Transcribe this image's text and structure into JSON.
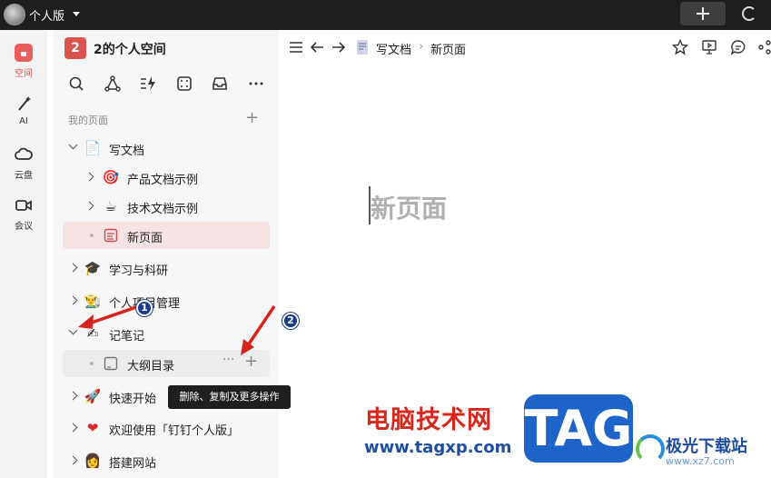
{
  "topbar": {
    "workspace_label": "个人版"
  },
  "rail": {
    "items": [
      {
        "label": "空间",
        "icon": "space-icon"
      },
      {
        "label": "AI",
        "icon": "ai-wand-icon"
      },
      {
        "label": "云盘",
        "icon": "cloud-icon"
      },
      {
        "label": "会议",
        "icon": "video-icon"
      }
    ]
  },
  "sidebar": {
    "space_badge": "2",
    "space_title": "2的个人空间",
    "section_label": "我的页面",
    "tree": [
      {
        "label": "写文档",
        "emoji": "📄"
      },
      {
        "label": "产品文档示例",
        "emoji": "🎯"
      },
      {
        "label": "技术文档示例",
        "emoji": "☕"
      },
      {
        "label": "新页面",
        "emoji": ""
      },
      {
        "label": "学习与科研",
        "emoji": "🎓"
      },
      {
        "label": "个人项目管理",
        "emoji": "👨‍🌾"
      },
      {
        "label": "记笔记",
        "emoji": "✍"
      },
      {
        "label": "大纲目录",
        "emoji": ""
      },
      {
        "label": "快速开始",
        "emoji": "🚀"
      },
      {
        "label": "欢迎使用「钉钉个人版」",
        "emoji": "❤"
      },
      {
        "label": "搭建网站",
        "emoji": "👩"
      }
    ],
    "row_more": "···",
    "tooltip": "删除、复制及更多操作"
  },
  "breadcrumb": {
    "parent": "写文档",
    "separator": "›",
    "current": "新页面"
  },
  "document": {
    "title": "新页面"
  },
  "annotations": {
    "marker1": "1",
    "marker2": "2"
  },
  "watermark": {
    "site_cn": "电脑技术网",
    "site_url": "www.tagxp.com",
    "tag": "TAG",
    "jg_name": "极光下载站",
    "jg_url": "www.xz7.com"
  },
  "colors": {
    "accent": "#e25050",
    "active_row": "#f6e4e4",
    "topbar": "#1e1e1e"
  }
}
